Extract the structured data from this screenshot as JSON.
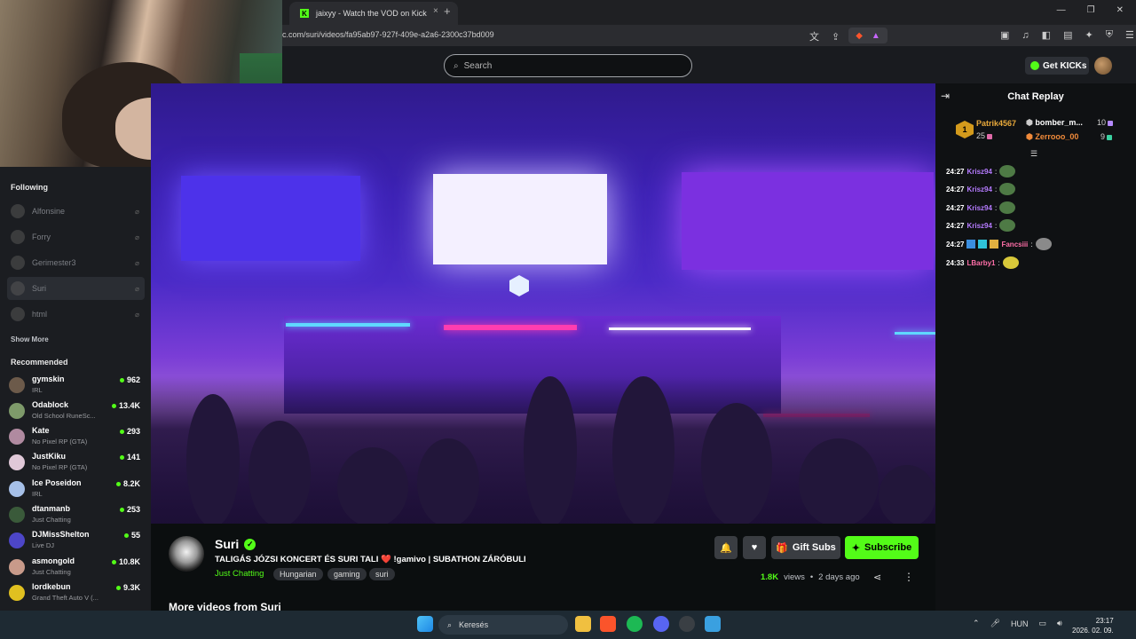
{
  "browser": {
    "tab_title": "jaixyy - Watch the VOD on Kick",
    "tab_close": "×",
    "new_tab": "+",
    "url": "c.com/suri/videos/fa95ab97-927f-409e-a2a6-2300c37bd009",
    "window_controls": [
      "—",
      "❐",
      "✕"
    ],
    "brave_count": "2"
  },
  "nav": {
    "search_placeholder": "Search",
    "get_kicks": "Get KICKs"
  },
  "sidebar": {
    "following_title": "Following",
    "following": [
      {
        "name": "Alfonsine"
      },
      {
        "name": "Forry"
      },
      {
        "name": "Gerimester3"
      },
      {
        "name": "Suri"
      },
      {
        "name": "html"
      }
    ],
    "show_more": "Show More",
    "recommended_title": "Recommended",
    "recommended": [
      {
        "name": "gymskin",
        "category": "IRL",
        "viewers": "962",
        "avatar_color": "#6c5a4a"
      },
      {
        "name": "Odablock",
        "category": "Old School RuneSc...",
        "viewers": "13.4K",
        "avatar_color": "#7e9a6a"
      },
      {
        "name": "Kate",
        "category": "No Pixel RP (GTA)",
        "viewers": "293",
        "avatar_color": "#b08aa0"
      },
      {
        "name": "JustKiku",
        "category": "No Pixel RP (GTA)",
        "viewers": "141",
        "avatar_color": "#e0c8d8"
      },
      {
        "name": "Ice Poseidon",
        "category": "IRL",
        "viewers": "8.2K",
        "avatar_color": "#a6c0e8"
      },
      {
        "name": "dtanmanb",
        "category": "Just Chatting",
        "viewers": "253",
        "avatar_color": "#3a5a3a"
      },
      {
        "name": "DJMissShelton",
        "category": "Live DJ",
        "viewers": "55",
        "avatar_color": "#4d46c8"
      },
      {
        "name": "asmongold",
        "category": "Just Chatting",
        "viewers": "10.8K",
        "avatar_color": "#c89a8a"
      },
      {
        "name": "lordkebun",
        "category": "Grand Theft Auto V (...",
        "viewers": "9.3K",
        "avatar_color": "#e0c020"
      }
    ]
  },
  "video_info": {
    "streamer": "Suri",
    "verified_mark": "✓",
    "title": "TALIGÁS JÓZSI KONCERT ÉS SURI TALI ❤️ !gamivo | SUBATHON ZÁRÓBULI",
    "category": "Just Chatting",
    "tags": [
      "Hungarian",
      "gaming",
      "suri"
    ],
    "gift_subs": "Gift Subs",
    "subscribe": "Subscribe",
    "views": "1.8K",
    "views_label": "views",
    "separator": "•",
    "age": "2 days ago",
    "more_videos": "More videos from Suri"
  },
  "chat": {
    "title": "Chat Replay",
    "leaderboard": [
      {
        "rank": "1",
        "name": "Patrik4567",
        "value": "25",
        "color": "#e8a93a"
      },
      {
        "name": "bomber_m...",
        "value": "10",
        "color": "#ffffff"
      },
      {
        "name": "Zerrooo_00",
        "value": "9",
        "color": "#f08a3a"
      }
    ],
    "messages": [
      {
        "time": "24:27",
        "user": "Krisz94",
        "color": "#b57bff"
      },
      {
        "time": "24:27",
        "user": "Krisz94",
        "color": "#b57bff"
      },
      {
        "time": "24:27",
        "user": "Krisz94",
        "color": "#b57bff"
      },
      {
        "time": "24:27",
        "user": "Krisz94",
        "color": "#b57bff"
      },
      {
        "time": "24:27",
        "user": "Fancsiii",
        "color": "#ff6fa8"
      },
      {
        "time": "24:33",
        "user": "LBarby1",
        "color": "#ff6fa8"
      }
    ]
  },
  "taskbar": {
    "search_text": "Keresés",
    "language": "HUN",
    "time": "23:17",
    "date": "2026. 02. 09."
  }
}
